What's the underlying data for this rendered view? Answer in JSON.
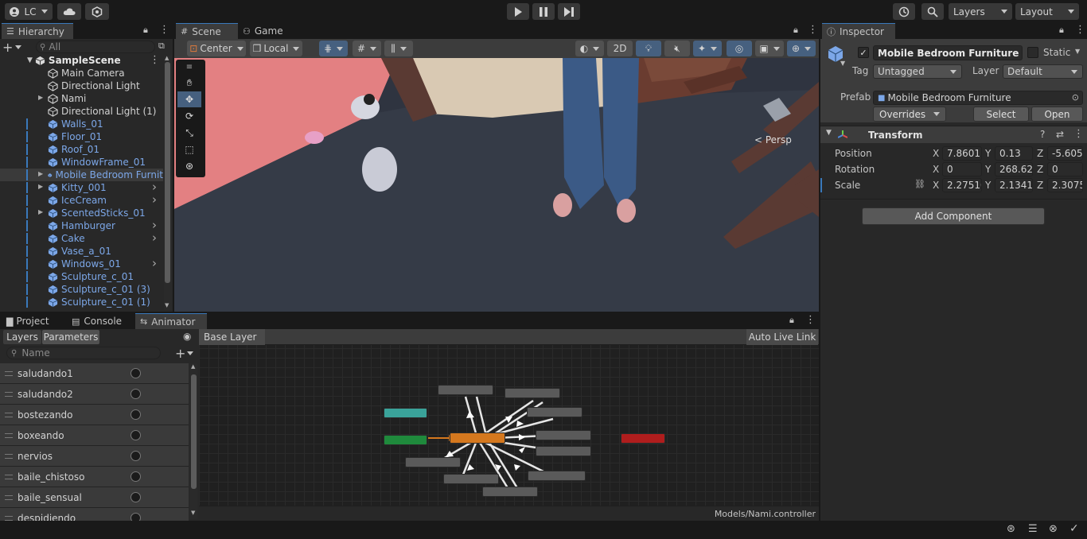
{
  "toolbar": {
    "account_label": "LC",
    "layers_label": "Layers",
    "layout_label": "Layout"
  },
  "hierarchy": {
    "tab": "Hierarchy",
    "search_placeholder": "All",
    "scene_name": "SampleScene",
    "items": [
      {
        "label": "Main Camera",
        "kind": "gameobject",
        "indent": 1
      },
      {
        "label": "Directional Light",
        "kind": "gameobject",
        "indent": 1
      },
      {
        "label": "Nami",
        "kind": "gameobject",
        "indent": 1,
        "expandable": true
      },
      {
        "label": "Directional Light (1)",
        "kind": "gameobject",
        "indent": 1
      },
      {
        "label": "Walls_01",
        "kind": "prefab",
        "indent": 1
      },
      {
        "label": "Floor_01",
        "kind": "prefab",
        "indent": 1
      },
      {
        "label": "Roof_01",
        "kind": "prefab",
        "indent": 1
      },
      {
        "label": "WindowFrame_01",
        "kind": "prefab",
        "indent": 1
      },
      {
        "label": "Mobile Bedroom Furnit",
        "kind": "prefab",
        "indent": 1,
        "expandable": true,
        "selected": true
      },
      {
        "label": "Kitty_001",
        "kind": "prefab",
        "indent": 1,
        "expandable": true,
        "chevron": true
      },
      {
        "label": "IceCream",
        "kind": "prefab",
        "indent": 1,
        "chevron": true
      },
      {
        "label": "ScentedSticks_01",
        "kind": "prefab",
        "indent": 1,
        "expandable": true
      },
      {
        "label": "Hamburger",
        "kind": "prefab",
        "indent": 1,
        "chevron": true
      },
      {
        "label": "Cake",
        "kind": "prefab",
        "indent": 1,
        "chevron": true
      },
      {
        "label": "Vase_a_01",
        "kind": "prefab",
        "indent": 1
      },
      {
        "label": "Windows_01",
        "kind": "prefab",
        "indent": 1,
        "chevron": true
      },
      {
        "label": "Sculpture_c_01",
        "kind": "prefab",
        "indent": 1
      },
      {
        "label": "Sculpture_c_01 (3)",
        "kind": "prefab",
        "indent": 1
      },
      {
        "label": "Sculpture_c_01 (1)",
        "kind": "prefab",
        "indent": 1
      }
    ]
  },
  "scene": {
    "tabs": [
      "Scene",
      "Game"
    ],
    "pivot_label": "Center",
    "space_label": "Local",
    "mode_2d": "2D",
    "persp_label": "< Persp"
  },
  "inspector": {
    "tab": "Inspector",
    "object_name": "Mobile Bedroom Furniture",
    "static_label": "Static",
    "tag_label": "Tag",
    "tag_value": "Untagged",
    "layer_label": "Layer",
    "layer_value": "Default",
    "prefab_label": "Prefab",
    "prefab_value": "Mobile Bedroom Furniture",
    "overrides_label": "Overrides",
    "select_label": "Select",
    "open_label": "Open",
    "transform_title": "Transform",
    "position": {
      "label": "Position",
      "x": "7.8601",
      "y": "0.13",
      "z": "-5.605"
    },
    "rotation": {
      "label": "Rotation",
      "x": "0",
      "y": "268.62",
      "z": "0"
    },
    "scale": {
      "label": "Scale",
      "x": "2.27510",
      "y": "2.13417",
      "z": "2.3075"
    },
    "axis_x": "X",
    "axis_y": "Y",
    "axis_z": "Z",
    "add_component": "Add Component"
  },
  "bottom": {
    "tabs": [
      "Project",
      "Console",
      "Animator"
    ],
    "layers_tab": "Layers",
    "parameters_tab": "Parameters",
    "search_placeholder": "Name",
    "base_layer": "Base Layer",
    "auto_live_link": "Auto Live Link",
    "controller_path": "Models/Nami.controller",
    "parameters": [
      "saludando1",
      "saludando2",
      "bostezando",
      "boxeando",
      "nervios",
      "baile_chistoso",
      "baile_sensual",
      "despidiendo"
    ]
  },
  "colors": {
    "accent": "#3a79bb",
    "prefab_text": "#7ca7e8",
    "entry_node": "#1f8a3c",
    "default_state": "#d5781e",
    "exit_node": "#b01d1d",
    "anystate_node": "#3aa39a"
  }
}
